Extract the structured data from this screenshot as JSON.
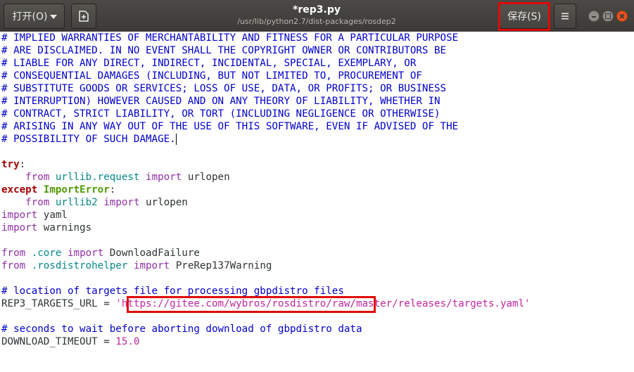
{
  "window": {
    "title": "*rep3.py",
    "subtitle": "/usr/lib/python2.7/dist-packages/rosdep2",
    "open_label": "打开(O)",
    "save_label": "保存(S)"
  },
  "icons": {
    "open_dropdown": "chevron-down-icon",
    "new_document": "new-document-icon",
    "menu": "hamburger-menu-icon",
    "minimize": "minimize-icon",
    "maximize": "maximize-icon",
    "close": "close-icon"
  },
  "colors": {
    "comment": "#0000c8",
    "keyword": "#a40000",
    "import": "#8f31a5",
    "module": "#08888a",
    "exception": "#4e9a06",
    "string": "#c0269e",
    "annotation": "#e00a0a"
  },
  "code": {
    "l1": "# IMPLIED WARRANTIES OF MERCHANTABILITY AND FITNESS FOR A PARTICULAR PURPOSE",
    "l2": "# ARE DISCLAIMED. IN NO EVENT SHALL THE COPYRIGHT OWNER OR CONTRIBUTORS BE",
    "l3": "# LIABLE FOR ANY DIRECT, INDIRECT, INCIDENTAL, SPECIAL, EXEMPLARY, OR",
    "l4": "# CONSEQUENTIAL DAMAGES (INCLUDING, BUT NOT LIMITED TO, PROCUREMENT OF",
    "l5": "# SUBSTITUTE GOODS OR SERVICES; LOSS OF USE, DATA, OR PROFITS; OR BUSINESS",
    "l6": "# INTERRUPTION) HOWEVER CAUSED AND ON ANY THEORY OF LIABILITY, WHETHER IN",
    "l7": "# CONTRACT, STRICT LIABILITY, OR TORT (INCLUDING NEGLIGENCE OR OTHERWISE)",
    "l8": "# ARISING IN ANY WAY OUT OF THE USE OF THIS SOFTWARE, EVEN IF ADVISED OF THE",
    "l9": "# POSSIBILITY OF SUCH DAMAGE.",
    "try_kw": "try",
    "colon": ":",
    "indent": "    ",
    "from_kw": "from",
    "import_kw": "import",
    "except_kw": "except",
    "mod_urllib_request": "urllib.request",
    "mod_urllib2": "urllib2",
    "urlopen": "urlopen",
    "import_error": "ImportError",
    "yaml": "yaml",
    "warnings": "warnings",
    "mod_core": ".core",
    "download_failure": "DownloadFailure",
    "mod_rosdistrohelper": ".rosdistrohelper",
    "prerep_warning": "PreRep137Warning",
    "comment_targets": "# location of targets file for processing gbpdistro files",
    "rep3_var": "REP3_TARGETS_URL = ",
    "rep3_url": "'https://gitee.com/wybros/rosdistro/raw/master/releases/targets.yaml'",
    "comment_timeout": "# seconds to wait before aborting download of gbpdistro data",
    "timeout_var": "DOWNLOAD_TIMEOUT = ",
    "timeout_val": "15.0"
  }
}
